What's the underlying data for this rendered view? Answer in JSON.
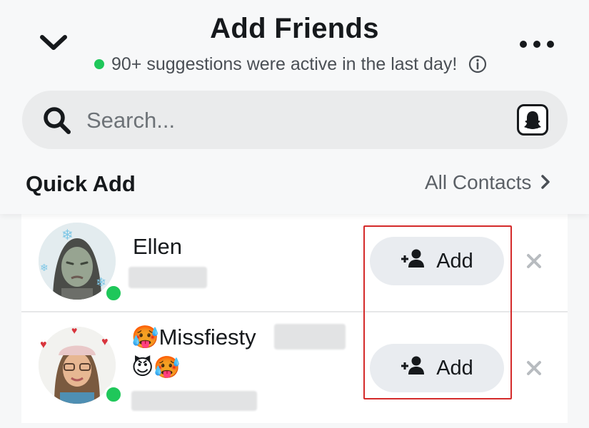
{
  "header": {
    "title": "Add Friends",
    "subtitle": "90+ suggestions were active in the last day!",
    "status_color": "#1fc75a"
  },
  "search": {
    "placeholder": "Search..."
  },
  "quick_add": {
    "title": "Quick Add",
    "all_contacts_label": "All Contacts"
  },
  "suggestions": [
    {
      "name": "Ellen",
      "add_label": "Add"
    },
    {
      "name": "Missfiesty",
      "name_emoji_prefix": "🥵",
      "emoji_line": "😈🥵",
      "add_label": "Add"
    }
  ],
  "icons": {
    "back": "chevron-down-icon",
    "menu": "more-icon",
    "info": "info-icon",
    "search": "search-icon",
    "ghost": "ghost-icon",
    "chevron": "chevron-right-icon",
    "add_friend": "add-friend-icon",
    "dismiss": "close-icon"
  },
  "annotation_color": "#d42a2a"
}
